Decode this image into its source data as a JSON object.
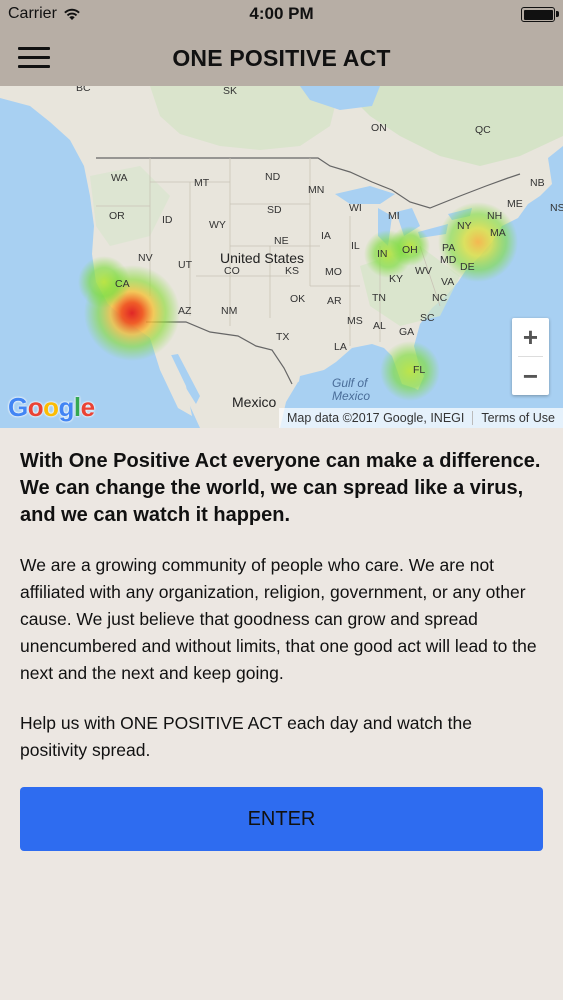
{
  "status_bar": {
    "carrier": "Carrier",
    "time": "4:00 PM",
    "wifi_icon": "wifi-icon",
    "battery_icon": "battery-icon"
  },
  "header": {
    "title": "ONE POSITIVE ACT",
    "menu_icon": "hamburger-menu-icon",
    "background": "#b7aea5"
  },
  "map": {
    "country_label": "United States",
    "mexico_label": "Mexico",
    "gulf_label_1": "Gulf of",
    "gulf_label_2": "Mexico",
    "state_labels": {
      "bc": "BC",
      "sk": "SK",
      "on": "ON",
      "qc": "QC",
      "nb": "NB",
      "ns": "NS",
      "wa": "WA",
      "mt": "MT",
      "nd": "ND",
      "mn": "MN",
      "wi": "WI",
      "mi": "MI",
      "me": "ME",
      "nh": "NH",
      "ny": "NY",
      "ma": "MA",
      "or": "OR",
      "id": "ID",
      "wy": "WY",
      "sd": "SD",
      "ia": "IA",
      "ne": "NE",
      "il": "IL",
      "in": "IN",
      "oh": "OH",
      "pa": "PA",
      "md": "MD",
      "de": "DE",
      "nv": "NV",
      "ut": "UT",
      "co": "CO",
      "ks": "KS",
      "mo": "MO",
      "ky": "KY",
      "wv": "WV",
      "va": "VA",
      "ca": "CA",
      "az": "AZ",
      "nm": "NM",
      "ok": "OK",
      "ar": "AR",
      "tn": "TN",
      "nc": "NC",
      "sc": "SC",
      "ms": "MS",
      "al": "AL",
      "ga": "GA",
      "tx": "TX",
      "la": "LA",
      "fl": "FL"
    },
    "zoom_in": "+",
    "zoom_out": "−",
    "logo": "Google",
    "attribution": "Map data ©2017 Google, INEGI",
    "terms": "Terms of Use",
    "colors": {
      "water": "#a8d0f2",
      "land": "#e8e5dc",
      "heat_low": "#7ddc3c",
      "heat_high": "#e53a2a"
    }
  },
  "content": {
    "headline": "With One Positive Act everyone can make a difference. We can change the world, we can spread like a virus, and we can watch it happen.",
    "paragraph1": "We are a growing community of people who care. We are not affiliated with any organization, religion, government, or any other cause. We just believe that goodness can grow and spread unencumbered and without limits, that one good act will lead to the next and the next and keep going.",
    "paragraph2": "Help us with ONE POSITIVE ACT each day and watch the positivity spread."
  },
  "enter_button": {
    "label": "ENTER",
    "color": "#2e6cf0"
  }
}
